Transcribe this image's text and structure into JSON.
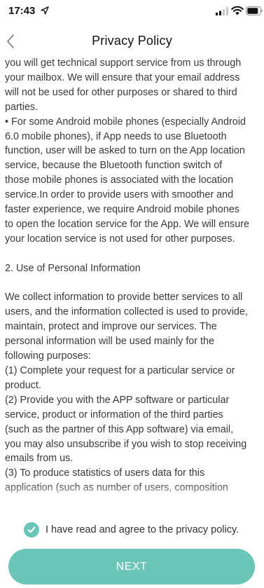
{
  "status_bar": {
    "time": "17:43"
  },
  "nav": {
    "title": "Privacy Policy",
    "back_icon": "chevron-left-icon"
  },
  "content": {
    "lines": [
      "you will get technical support service from us through",
      "your mailbox. We will ensure that your email address",
      "will not be used for other purposes or shared to third",
      "parties.",
      "• For some Android mobile phones (especially Android",
      "6.0 mobile phones), if App needs to use Bluetooth",
      "function, user will be asked to turn on the App location",
      "service, because the Bluetooth function switch of",
      "those mobile phones is associated with the location",
      "service.In order to provide users with smoother and",
      "faster experience, we require Android mobile phones",
      "to open the location service for the App. We will ensure",
      "your location service is not used for other purposes.",
      "",
      "2. Use of Personal Information",
      "",
      "We collect information to provide better services to all",
      "users, and the information collected is used to provide,",
      "maintain, protect and improve our services. The",
      "personal information will be used mainly for the",
      "following purposes:",
      "(1) Complete your request for a particular service or",
      "product.",
      "(2) Provide you with the APP software or particular",
      "service, product or information of the third parties",
      "(such as the partner of this App software) via email,",
      "you may also unsubscribe if you wish to stop receiving",
      "emails from us.",
      "(3) To produce statistics of users data for this",
      "application (such as number of users, composition"
    ]
  },
  "agreement": {
    "label": "I have read and agree to the privacy policy.",
    "checked": true
  },
  "next_button": {
    "label": "NEXT"
  },
  "colors": {
    "accent": "#6cc6b8",
    "text": "#3a3a3a"
  }
}
